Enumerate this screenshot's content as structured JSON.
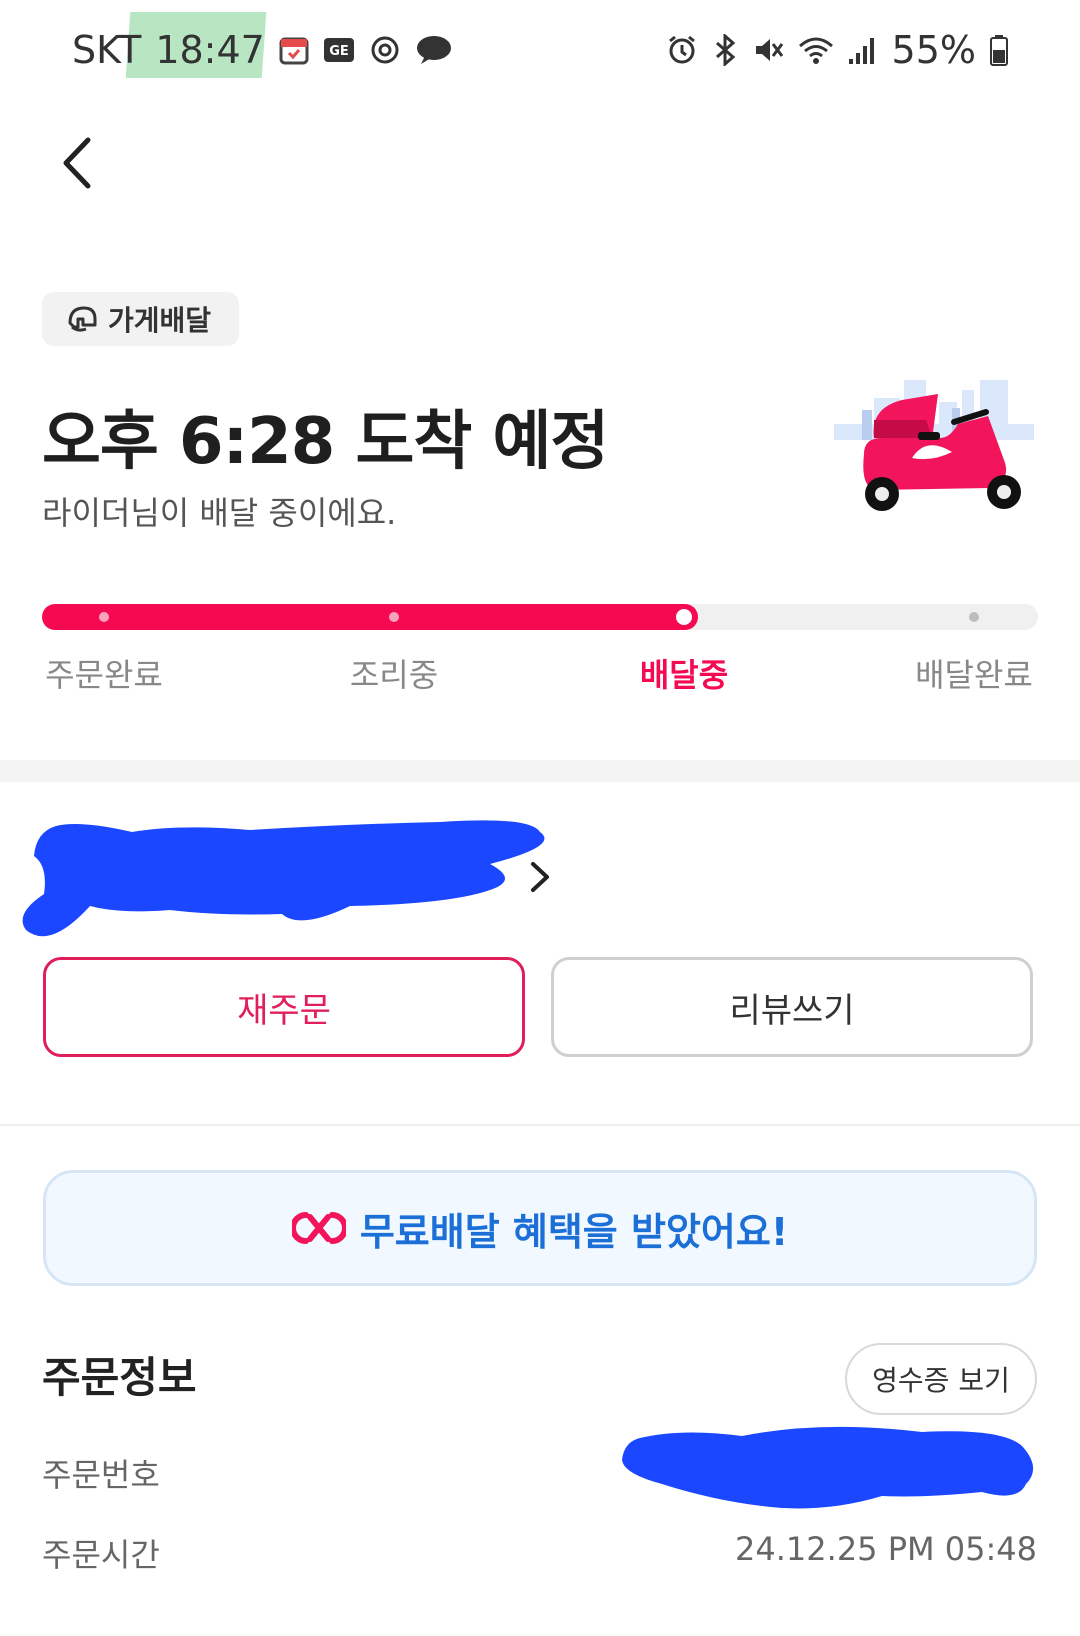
{
  "status_bar": {
    "carrier": "SKT",
    "time": "18:47",
    "battery": "55%"
  },
  "delivery_type_chip": "가게배달",
  "eta_title": "오후 6:28 도착 예정",
  "status_message": "라이더님이 배달 중이에요.",
  "progress": {
    "steps": [
      "주문완료",
      "조리중",
      "배달중",
      "배달완료"
    ],
    "current_step_index": 2
  },
  "actions": {
    "reorder": "재주문",
    "write_review": "리뷰쓰기"
  },
  "benefit_banner": "무료배달 혜택을 받았어요!",
  "order_info": {
    "title": "주문정보",
    "receipt_button": "영수증 보기",
    "order_number_label": "주문번호",
    "order_time_label": "주문시간",
    "order_time_value": "24.12.25 PM 05:48"
  },
  "colors": {
    "accent": "#f50a52",
    "benefit_blue": "#1b6fd6",
    "redaction_blue": "#1a47ff"
  }
}
